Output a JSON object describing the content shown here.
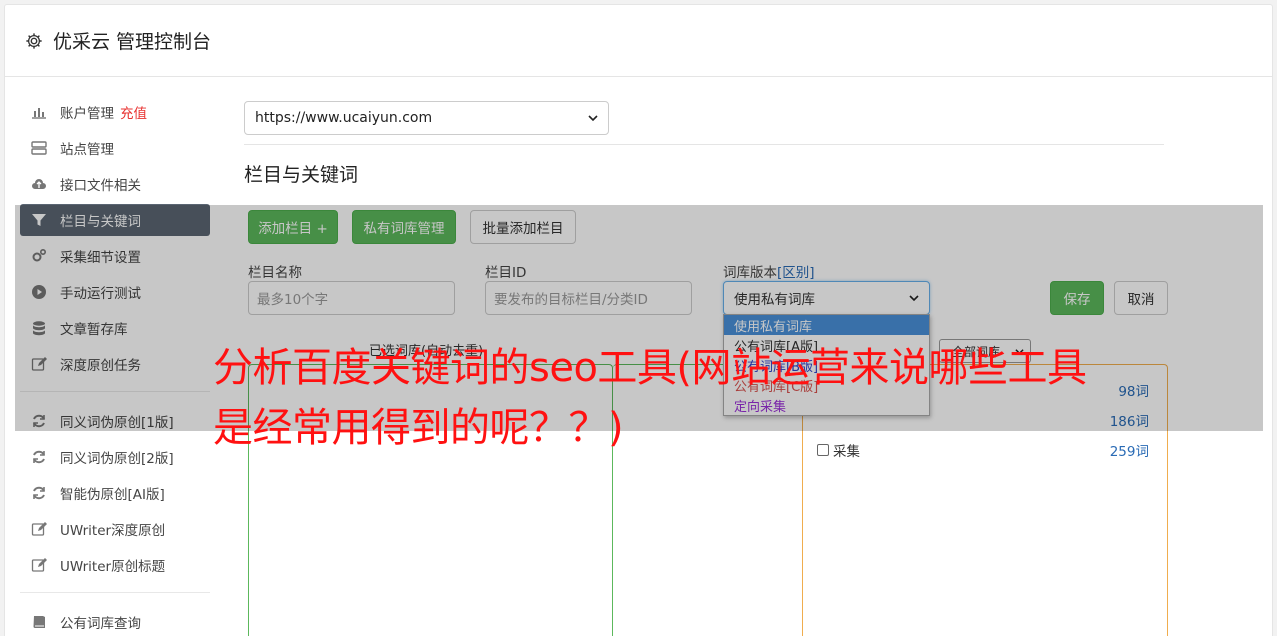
{
  "header": {
    "title": "优采云 管理控制台",
    "icon": "gear-icon"
  },
  "sidebar": {
    "group1": [
      {
        "label": "账户管理",
        "badge": "充值",
        "icon": "bar-chart-icon",
        "active": false
      },
      {
        "label": "站点管理",
        "icon": "server-icon",
        "active": false
      },
      {
        "label": "接口文件相关",
        "icon": "cloud-upload-icon",
        "active": false
      },
      {
        "label": "栏目与关键词",
        "icon": "filter-icon",
        "active": true
      },
      {
        "label": "采集细节设置",
        "icon": "cogs-icon",
        "active": false
      },
      {
        "label": "手动运行测试",
        "icon": "play-circle-icon",
        "active": false
      },
      {
        "label": "文章暂存库",
        "icon": "database-icon",
        "active": false
      },
      {
        "label": "深度原创任务",
        "icon": "edit-icon",
        "active": false
      }
    ],
    "group2": [
      {
        "label": "同义词伪原创[1版]",
        "icon": "refresh-icon"
      },
      {
        "label": "同义词伪原创[2版]",
        "icon": "refresh-icon"
      },
      {
        "label": "智能伪原创[AI版]",
        "icon": "refresh-icon"
      },
      {
        "label": "UWriter深度原创",
        "icon": "edit-icon"
      },
      {
        "label": "UWriter原创标题",
        "icon": "edit-icon"
      }
    ],
    "group3": [
      {
        "label": "公有词库查询",
        "icon": "book-icon"
      }
    ]
  },
  "main": {
    "url_select": "https://www.ucaiyun.com",
    "section_title": "栏目与关键词",
    "buttons": {
      "add_column": "添加栏目 +",
      "private_lib": "私有词库管理",
      "batch_add": "批量添加栏目"
    },
    "form": {
      "column_name_label": "栏目名称",
      "column_name_placeholder": "最多10个字",
      "column_id_label": "栏目ID",
      "column_id_placeholder": "要发布的目标栏目/分类ID",
      "lib_version_label": "词库版本",
      "lib_version_link": "[区别]",
      "lib_version_value": "使用私有词库",
      "save": "保存",
      "cancel": "取消"
    },
    "dropdown_options": [
      {
        "label": "使用私有词库",
        "color": "#ffffff",
        "selected": true
      },
      {
        "label": "公有词库[A版]",
        "color": "#333333"
      },
      {
        "label": "公有词库[B版]",
        "color": "#3344cc"
      },
      {
        "label": "公有词库[C版]",
        "color": "#d9534f"
      },
      {
        "label": "定向采集",
        "color": "#9b30d9"
      }
    ],
    "selected_libs_legend": "已选词库(自动去重)",
    "all_libs_filter": "全部词库",
    "lib_list": [
      {
        "name": "",
        "count": "98词"
      },
      {
        "name": "",
        "count": "186词"
      },
      {
        "name": "采集",
        "count": "259词"
      }
    ]
  },
  "overlay_text": "分析百度关键词的seo工具(网站运营来说哪些工具是经常用得到的呢？？)",
  "colors": {
    "green": "#5cb85c",
    "active_nav": "#5b6673",
    "danger": "#e8312f",
    "link": "#2a6bb5"
  }
}
